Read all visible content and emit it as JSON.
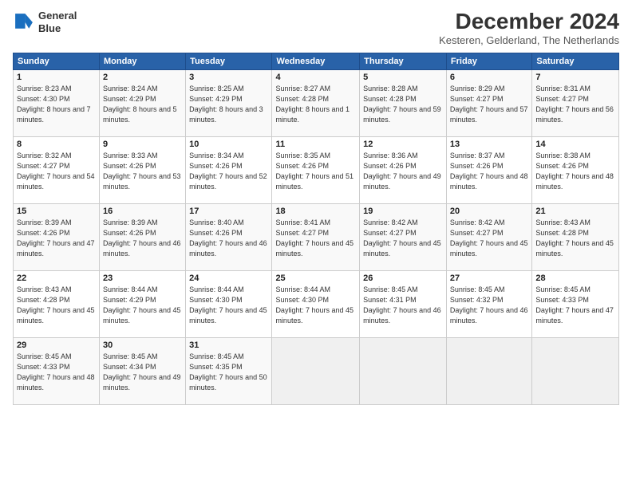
{
  "header": {
    "logo_line1": "General",
    "logo_line2": "Blue",
    "month_title": "December 2024",
    "subtitle": "Kesteren, Gelderland, The Netherlands"
  },
  "days_of_week": [
    "Sunday",
    "Monday",
    "Tuesday",
    "Wednesday",
    "Thursday",
    "Friday",
    "Saturday"
  ],
  "weeks": [
    [
      {
        "day": "1",
        "sunrise": "8:23 AM",
        "sunset": "4:30 PM",
        "daylight": "8 hours and 7 minutes."
      },
      {
        "day": "2",
        "sunrise": "8:24 AM",
        "sunset": "4:29 PM",
        "daylight": "8 hours and 5 minutes."
      },
      {
        "day": "3",
        "sunrise": "8:25 AM",
        "sunset": "4:29 PM",
        "daylight": "8 hours and 3 minutes."
      },
      {
        "day": "4",
        "sunrise": "8:27 AM",
        "sunset": "4:28 PM",
        "daylight": "8 hours and 1 minute."
      },
      {
        "day": "5",
        "sunrise": "8:28 AM",
        "sunset": "4:28 PM",
        "daylight": "7 hours and 59 minutes."
      },
      {
        "day": "6",
        "sunrise": "8:29 AM",
        "sunset": "4:27 PM",
        "daylight": "7 hours and 57 minutes."
      },
      {
        "day": "7",
        "sunrise": "8:31 AM",
        "sunset": "4:27 PM",
        "daylight": "7 hours and 56 minutes."
      }
    ],
    [
      {
        "day": "8",
        "sunrise": "8:32 AM",
        "sunset": "4:27 PM",
        "daylight": "7 hours and 54 minutes."
      },
      {
        "day": "9",
        "sunrise": "8:33 AM",
        "sunset": "4:26 PM",
        "daylight": "7 hours and 53 minutes."
      },
      {
        "day": "10",
        "sunrise": "8:34 AM",
        "sunset": "4:26 PM",
        "daylight": "7 hours and 52 minutes."
      },
      {
        "day": "11",
        "sunrise": "8:35 AM",
        "sunset": "4:26 PM",
        "daylight": "7 hours and 51 minutes."
      },
      {
        "day": "12",
        "sunrise": "8:36 AM",
        "sunset": "4:26 PM",
        "daylight": "7 hours and 49 minutes."
      },
      {
        "day": "13",
        "sunrise": "8:37 AM",
        "sunset": "4:26 PM",
        "daylight": "7 hours and 48 minutes."
      },
      {
        "day": "14",
        "sunrise": "8:38 AM",
        "sunset": "4:26 PM",
        "daylight": "7 hours and 48 minutes."
      }
    ],
    [
      {
        "day": "15",
        "sunrise": "8:39 AM",
        "sunset": "4:26 PM",
        "daylight": "7 hours and 47 minutes."
      },
      {
        "day": "16",
        "sunrise": "8:39 AM",
        "sunset": "4:26 PM",
        "daylight": "7 hours and 46 minutes."
      },
      {
        "day": "17",
        "sunrise": "8:40 AM",
        "sunset": "4:26 PM",
        "daylight": "7 hours and 46 minutes."
      },
      {
        "day": "18",
        "sunrise": "8:41 AM",
        "sunset": "4:27 PM",
        "daylight": "7 hours and 45 minutes."
      },
      {
        "day": "19",
        "sunrise": "8:42 AM",
        "sunset": "4:27 PM",
        "daylight": "7 hours and 45 minutes."
      },
      {
        "day": "20",
        "sunrise": "8:42 AM",
        "sunset": "4:27 PM",
        "daylight": "7 hours and 45 minutes."
      },
      {
        "day": "21",
        "sunrise": "8:43 AM",
        "sunset": "4:28 PM",
        "daylight": "7 hours and 45 minutes."
      }
    ],
    [
      {
        "day": "22",
        "sunrise": "8:43 AM",
        "sunset": "4:28 PM",
        "daylight": "7 hours and 45 minutes."
      },
      {
        "day": "23",
        "sunrise": "8:44 AM",
        "sunset": "4:29 PM",
        "daylight": "7 hours and 45 minutes."
      },
      {
        "day": "24",
        "sunrise": "8:44 AM",
        "sunset": "4:30 PM",
        "daylight": "7 hours and 45 minutes."
      },
      {
        "day": "25",
        "sunrise": "8:44 AM",
        "sunset": "4:30 PM",
        "daylight": "7 hours and 45 minutes."
      },
      {
        "day": "26",
        "sunrise": "8:45 AM",
        "sunset": "4:31 PM",
        "daylight": "7 hours and 46 minutes."
      },
      {
        "day": "27",
        "sunrise": "8:45 AM",
        "sunset": "4:32 PM",
        "daylight": "7 hours and 46 minutes."
      },
      {
        "day": "28",
        "sunrise": "8:45 AM",
        "sunset": "4:33 PM",
        "daylight": "7 hours and 47 minutes."
      }
    ],
    [
      {
        "day": "29",
        "sunrise": "8:45 AM",
        "sunset": "4:33 PM",
        "daylight": "7 hours and 48 minutes."
      },
      {
        "day": "30",
        "sunrise": "8:45 AM",
        "sunset": "4:34 PM",
        "daylight": "7 hours and 49 minutes."
      },
      {
        "day": "31",
        "sunrise": "8:45 AM",
        "sunset": "4:35 PM",
        "daylight": "7 hours and 50 minutes."
      },
      null,
      null,
      null,
      null
    ]
  ]
}
